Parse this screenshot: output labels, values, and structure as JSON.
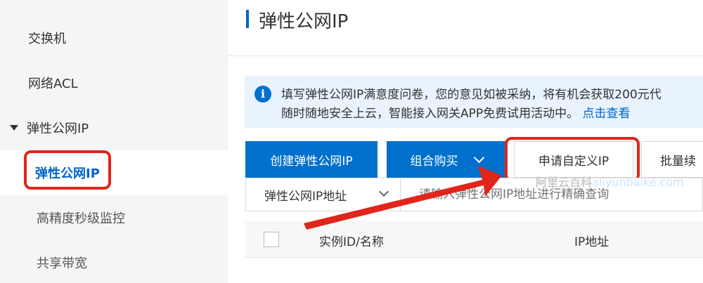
{
  "sidebar": {
    "items": [
      {
        "label": "交换机"
      },
      {
        "label": "网络ACL"
      },
      {
        "label": "弹性公网IP"
      },
      {
        "label": "弹性公网IP"
      },
      {
        "label": "高精度秒级监控"
      },
      {
        "label": "共享带宽"
      }
    ]
  },
  "header": {
    "title": "弹性公网IP"
  },
  "notice": {
    "line1": "填写弹性公网IP满意度问卷，您的意见如被采纳，将有机会获取200元代",
    "line2": "随时随地安全上云，智能接入网关APP免费试用活动中。",
    "link": "点击查看"
  },
  "toolbar": {
    "create": "创建弹性公网IP",
    "combo": "组合购买",
    "custom": "申请自定义IP",
    "batch": "批量续"
  },
  "search": {
    "select": "弹性公网IP地址",
    "placeholder": "请输入弹性公网IP地址进行精确查询"
  },
  "table": {
    "columns": [
      "实例ID/名称",
      "IP地址"
    ]
  },
  "watermark": {
    "cn": "阿里云百科",
    "en": "aliyunbaike.com"
  },
  "colors": {
    "accent": "#0064c8",
    "primary_button": "#0070cc",
    "highlight_red": "#e0251b",
    "notice_bg": "#e8f3fd",
    "sidebar_bg": "#f5f5f6"
  }
}
